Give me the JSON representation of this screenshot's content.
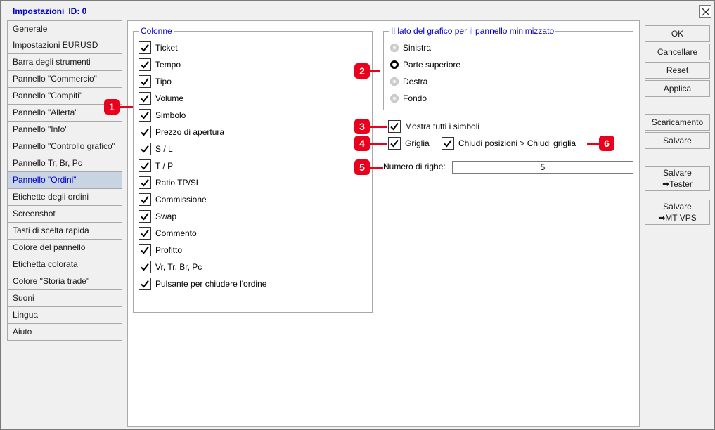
{
  "window": {
    "title": "Impostazioni",
    "id_label": "ID: 0"
  },
  "tabs": [
    {
      "label": "Generale"
    },
    {
      "label": "Impostazioni EURUSD"
    },
    {
      "label": "Barra degli strumenti"
    },
    {
      "label": "Pannello \"Commercio\""
    },
    {
      "label": "Pannello \"Compiti\""
    },
    {
      "label": "Pannello \"Allerta\""
    },
    {
      "label": "Pannello \"Info\""
    },
    {
      "label": "Pannello \"Controllo grafico\""
    },
    {
      "label": "Pannello Tr, Br, Pc"
    },
    {
      "label": "Pannello \"Ordini\"",
      "active": true
    },
    {
      "label": "Etichette degli ordini"
    },
    {
      "label": "Screenshot"
    },
    {
      "label": "Tasti di scelta rapida"
    },
    {
      "label": "Colore del pannello"
    },
    {
      "label": "Etichetta colorata"
    },
    {
      "label": "Colore \"Storia trade\""
    },
    {
      "label": "Suoni"
    },
    {
      "label": "Lingua"
    },
    {
      "label": "Aiuto"
    }
  ],
  "columns": {
    "legend": "Colonne",
    "items": [
      {
        "label": "Ticket",
        "checked": true
      },
      {
        "label": "Tempo",
        "checked": true
      },
      {
        "label": "Tipo",
        "checked": true
      },
      {
        "label": "Volume",
        "checked": true
      },
      {
        "label": "Simbolo",
        "checked": true
      },
      {
        "label": "Prezzo di apertura",
        "checked": true
      },
      {
        "label": "S / L",
        "checked": true
      },
      {
        "label": "T / P",
        "checked": true
      },
      {
        "label": "Ratio TP/SL",
        "checked": true
      },
      {
        "label": "Commissione",
        "checked": true
      },
      {
        "label": "Swap",
        "checked": true
      },
      {
        "label": "Commento",
        "checked": true
      },
      {
        "label": "Profitto",
        "checked": true
      },
      {
        "label": "Vr, Tr, Br, Pc",
        "checked": true
      },
      {
        "label": "Pulsante per chiudere l'ordine",
        "checked": true
      }
    ]
  },
  "side": {
    "legend": "Il lato del grafico per il pannello minimizzato",
    "options": [
      {
        "label": "Sinistra",
        "selected": false
      },
      {
        "label": "Parte superiore",
        "selected": true
      },
      {
        "label": "Destra",
        "selected": false
      },
      {
        "label": "Fondo",
        "selected": false
      }
    ]
  },
  "options": {
    "show_all_symbols": {
      "label": "Mostra tutti i simboli",
      "checked": true
    },
    "grid": {
      "label": "Griglia",
      "checked": true
    },
    "close_positions": {
      "label": "Chiudi posizioni > Chiudi griglia",
      "checked": true
    },
    "rows_label": "Numero di righe:",
    "rows_value": "5"
  },
  "markers": [
    "1",
    "2",
    "3",
    "4",
    "5",
    "6"
  ],
  "buttons": {
    "ok": "OK",
    "cancel": "Cancellare",
    "reset": "Reset",
    "apply": "Applica",
    "download": "Scaricamento",
    "save": "Salvare",
    "save_tester_1": "Salvare",
    "save_tester_2": "➡Tester",
    "save_vps_1": "Salvare",
    "save_vps_2": "➡MT VPS"
  },
  "colors": {
    "accent_blue": "#0000cc",
    "marker_red": "#e8001c",
    "active_tab_bg": "#c9d4e3"
  }
}
